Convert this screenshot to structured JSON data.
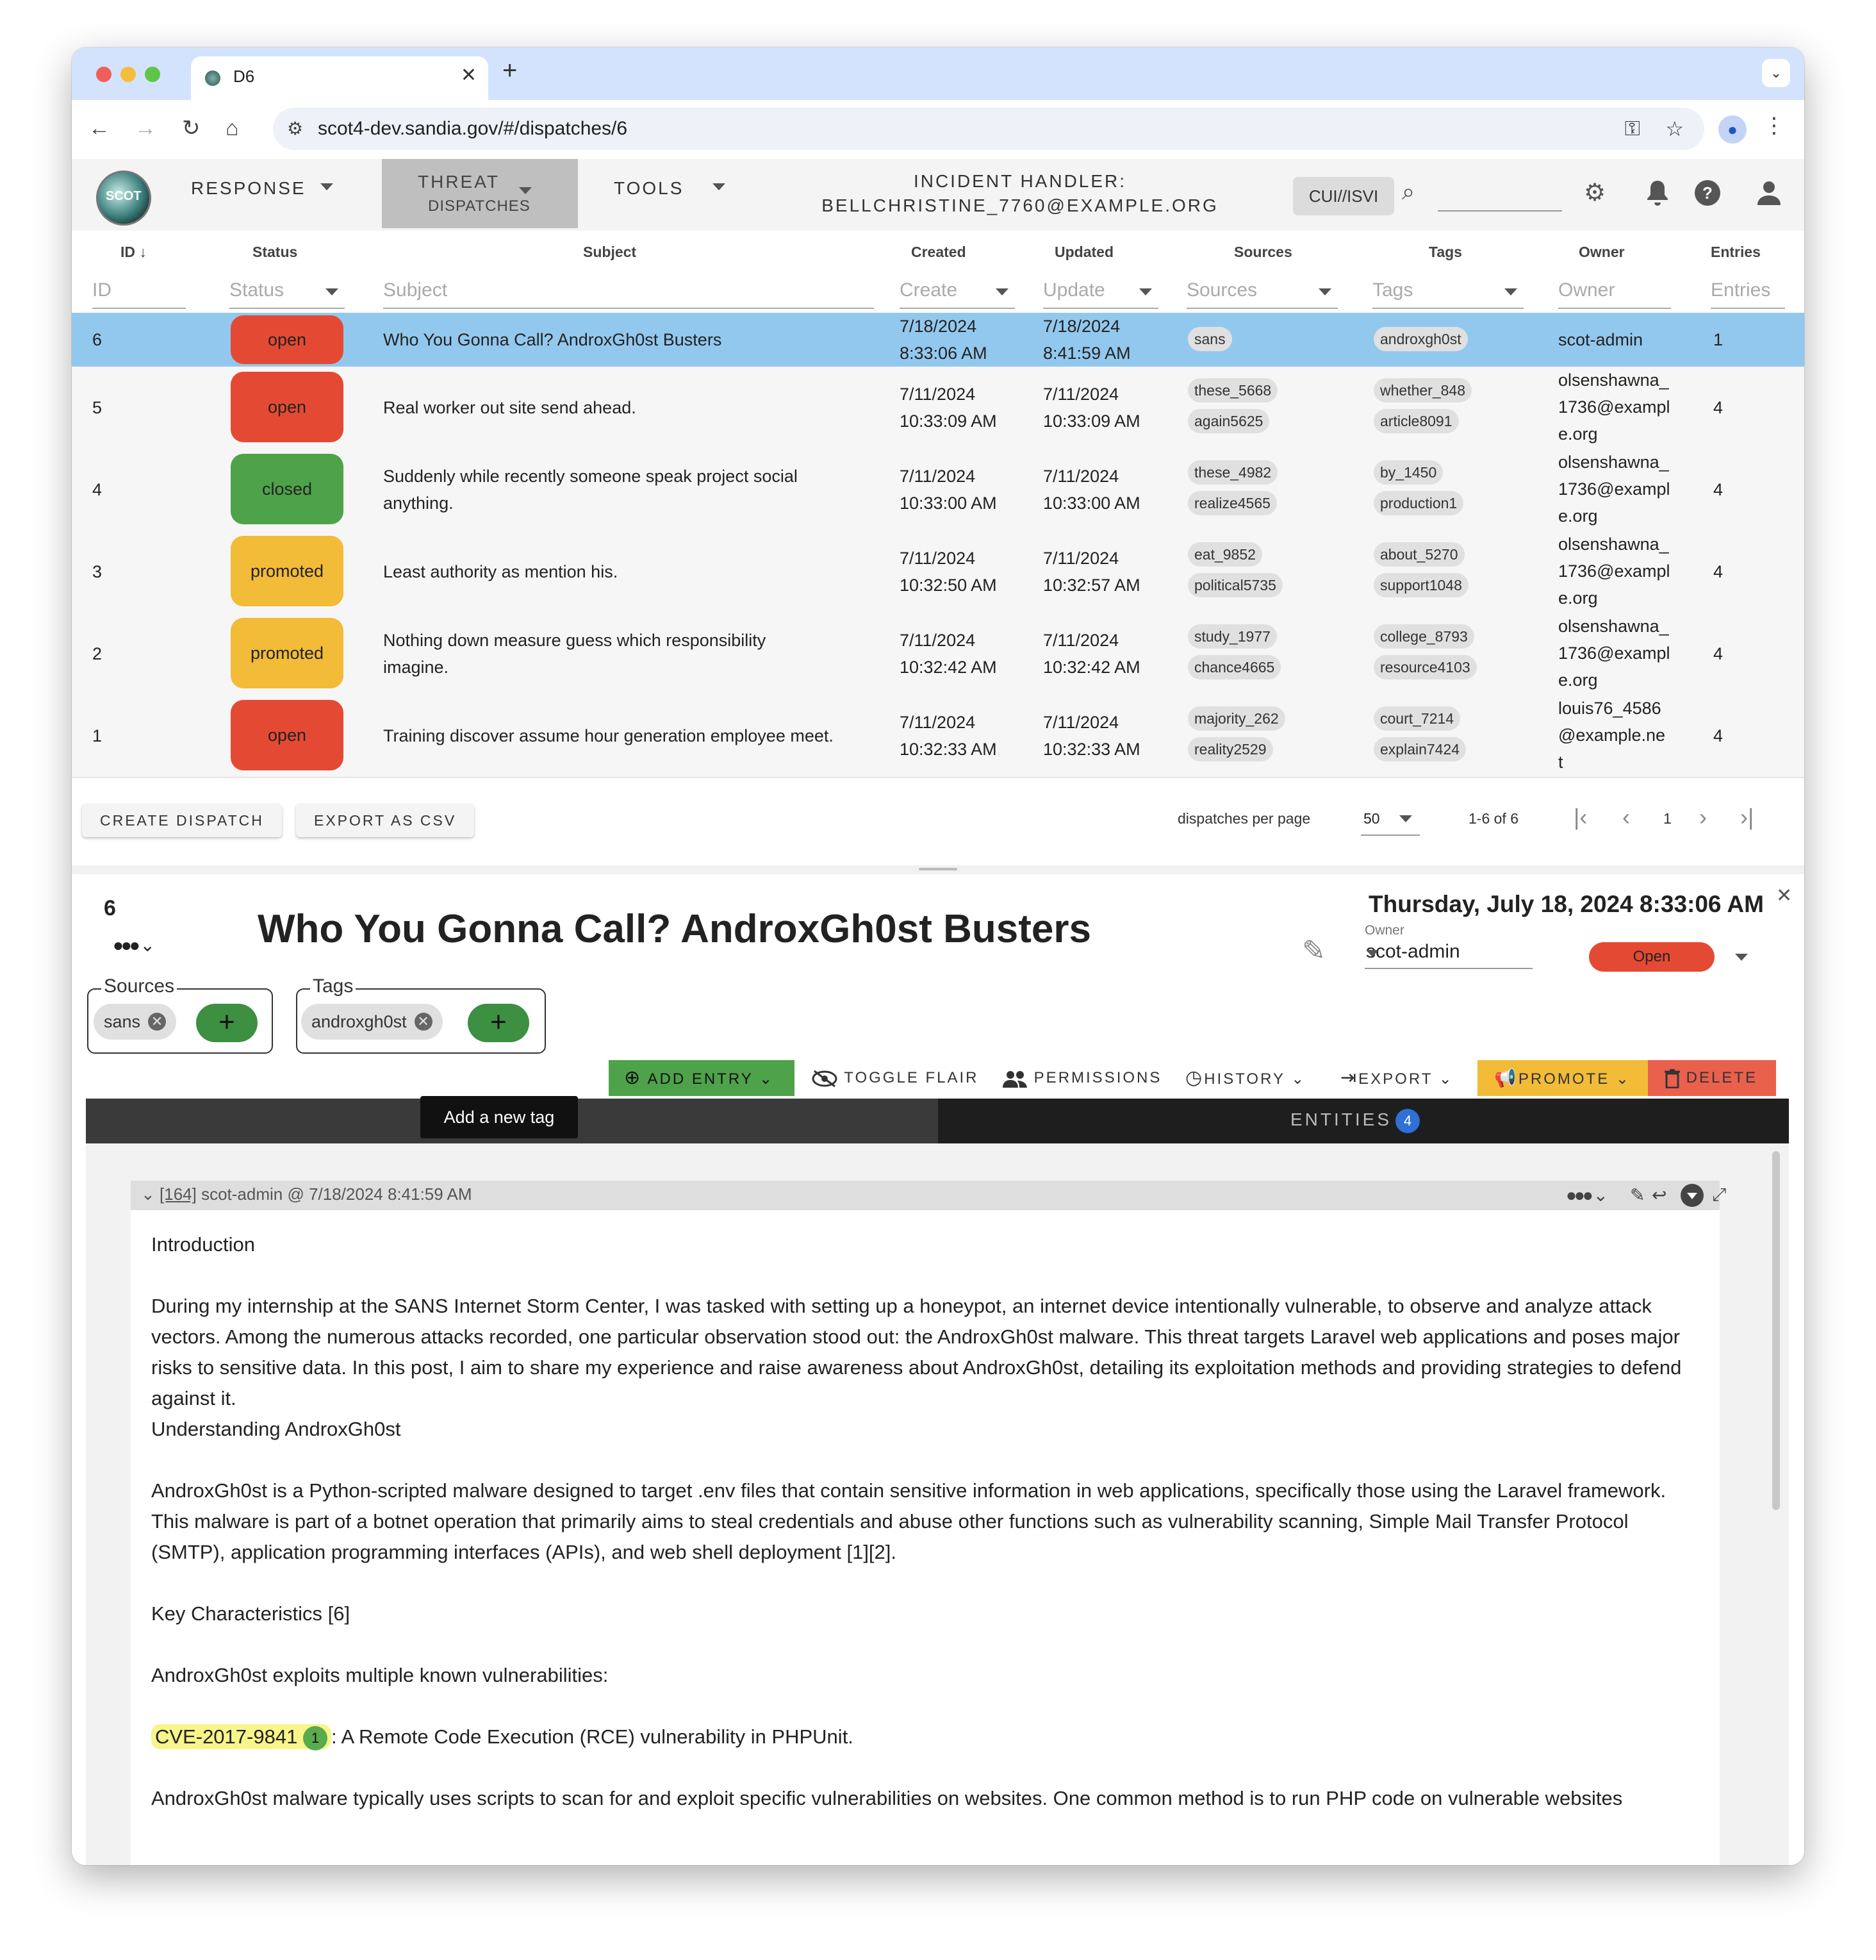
{
  "browser": {
    "tab_title": "D6",
    "url": "scot4-dev.sandia.gov/#/dispatches/6"
  },
  "app": {
    "menu_response": "RESPONSE",
    "menu_threat_1": "THREAT",
    "menu_threat_2": "DISPATCHES",
    "menu_tools": "TOOLS",
    "handler_label": "INCIDENT HANDLER:",
    "handler_email": "BELLCHRISTINE_7760@EXAMPLE.ORG",
    "classification": "CUI//ISVI",
    "logo_text": "SCOT"
  },
  "table": {
    "headers": {
      "id": "ID",
      "status": "Status",
      "subject": "Subject",
      "created": "Created",
      "updated": "Updated",
      "sources": "Sources",
      "tags": "Tags",
      "owner": "Owner",
      "entries": "Entries"
    },
    "filters": {
      "id": "ID",
      "status": "Status",
      "subject": "Subject",
      "created": "Create",
      "updated": "Update",
      "sources": "Sources",
      "tags": "Tags",
      "owner": "Owner",
      "entries": "Entries"
    },
    "rows": [
      {
        "id": "6",
        "status": "open",
        "subject": "Who You Gonna Call? AndroxGh0st Busters",
        "subject2": "",
        "created1": "7/18/2024",
        "created2": "8:33:06 AM",
        "updated1": "7/18/2024",
        "updated2": "8:41:59 AM",
        "source1": "sans",
        "source2": "",
        "tag1": "androxgh0st",
        "tag2": "",
        "owner1": "scot-admin",
        "owner2": "",
        "owner3": "",
        "entries": "1"
      },
      {
        "id": "5",
        "status": "open",
        "subject": "Real worker out site send ahead.",
        "subject2": "",
        "created1": "7/11/2024",
        "created2": "10:33:09 AM",
        "updated1": "7/11/2024",
        "updated2": "10:33:09 AM",
        "source1": "these_5668",
        "source2": "again5625",
        "tag1": "whether_848",
        "tag2": "article8091",
        "owner1": "olsenshawna_",
        "owner2": "1736@exampl",
        "owner3": "e.org",
        "entries": "4"
      },
      {
        "id": "4",
        "status": "closed",
        "subject": "Suddenly while recently someone speak project social",
        "subject2": "anything.",
        "created1": "7/11/2024",
        "created2": "10:33:00 AM",
        "updated1": "7/11/2024",
        "updated2": "10:33:00 AM",
        "source1": "these_4982",
        "source2": "realize4565",
        "tag1": "by_1450",
        "tag2": "production1",
        "owner1": "olsenshawna_",
        "owner2": "1736@exampl",
        "owner3": "e.org",
        "entries": "4"
      },
      {
        "id": "3",
        "status": "promoted",
        "subject": "Least authority as mention his.",
        "subject2": "",
        "created1": "7/11/2024",
        "created2": "10:32:50 AM",
        "updated1": "7/11/2024",
        "updated2": "10:32:57 AM",
        "source1": "eat_9852",
        "source2": "political5735",
        "tag1": "about_5270",
        "tag2": "support1048",
        "owner1": "olsenshawna_",
        "owner2": "1736@exampl",
        "owner3": "e.org",
        "entries": "4"
      },
      {
        "id": "2",
        "status": "promoted",
        "subject": "Nothing down measure guess which responsibility",
        "subject2": "imagine.",
        "created1": "7/11/2024",
        "created2": "10:32:42 AM",
        "updated1": "7/11/2024",
        "updated2": "10:32:42 AM",
        "source1": "study_1977",
        "source2": "chance4665",
        "tag1": "college_8793",
        "tag2": "resource4103",
        "owner1": "olsenshawna_",
        "owner2": "1736@exampl",
        "owner3": "e.org",
        "entries": "4"
      },
      {
        "id": "1",
        "status": "open",
        "subject": "Training discover assume hour generation employee meet.",
        "subject2": "",
        "created1": "7/11/2024",
        "created2": "10:32:33 AM",
        "updated1": "7/11/2024",
        "updated2": "10:32:33 AM",
        "source1": "majority_262",
        "source2": "reality2529",
        "tag1": "court_7214",
        "tag2": "explain7424",
        "owner1": "louis76_4586",
        "owner2": "@example.ne",
        "owner3": "t",
        "entries": "4"
      }
    ],
    "status_colors": {
      "open": "#e44a33",
      "closed": "#4ea24a",
      "promoted": "#f2bb38"
    }
  },
  "footer": {
    "create_label": "CREATE DISPATCH",
    "export_label": "EXPORT AS CSV",
    "per_page_label": "dispatches per page",
    "per_page_value": "50",
    "range": "1-6 of 6",
    "page": "1"
  },
  "detail": {
    "id": "6",
    "title": "Who You Gonna Call? AndroxGh0st Busters",
    "datetime": "Thursday, July 18, 2024 8:33:06 AM",
    "owner_label": "Owner",
    "owner": "scot-admin",
    "status": "Open",
    "sources_legend": "Sources",
    "source_chip": "sans",
    "tags_legend": "Tags",
    "tag_chip": "androxgh0st",
    "tooltip": "Add a new tag",
    "actions": {
      "add_entry": "ADD ENTRY",
      "toggle_flair": "TOGGLE FLAIR",
      "permissions": "PERMISSIONS",
      "history": "HISTORY",
      "export": "EXPORT",
      "promote": "PROMOTE",
      "delete": "DELETE"
    },
    "entities_label": "ENTITIES",
    "entities_count": "4"
  },
  "entry": {
    "id_link": "[164]",
    "meta": " scot-admin @ 7/18/2024 8:41:59 AM",
    "p1": "Introduction",
    "p2": "During my internship at the SANS Internet Storm Center, I was tasked with setting up a honeypot, an internet device intentionally vulnerable, to observe and analyze attack vectors. Among the numerous attacks recorded, one particular observation stood out: the AndroxGh0st malware. This threat targets Laravel web applications and poses major risks to sensitive data. In this post, I aim to share my experience and raise awareness about AndroxGh0st, detailing its exploitation methods and providing strategies to defend against it.",
    "p3": "Understanding AndroxGh0st",
    "p4": "AndroxGh0st is a Python-scripted malware designed to target .env files that contain sensitive information in web applications, specifically those using the Laravel framework. This malware is part of a botnet operation that primarily aims to steal credentials and abuse other functions such as vulnerability scanning, Simple Mail Transfer Protocol (SMTP), application programming interfaces (APIs), and web shell deployment [1][2].",
    "p5": "Key Characteristics [6]",
    "p6": "AndroxGh0st exploits multiple known vulnerabilities:",
    "cve": "CVE-2017-9841",
    "cve_count": "1",
    "p7_rest": ": A Remote Code Execution (RCE) vulnerability in PHPUnit.",
    "p8": "AndroxGh0st malware typically uses scripts to scan for and exploit specific vulnerabilities on websites. One common method is to run PHP code on vulnerable websites"
  }
}
